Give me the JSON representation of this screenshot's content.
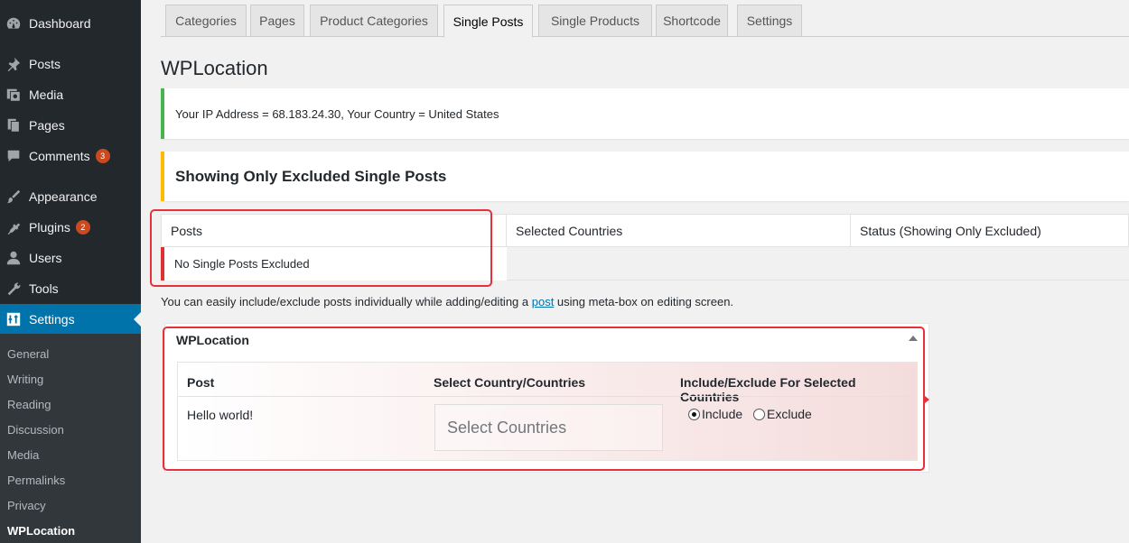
{
  "sidebar": {
    "items": [
      {
        "label": "Dashboard",
        "icon": "dashboard-icon"
      },
      {
        "label": "Posts",
        "icon": "pin-icon"
      },
      {
        "label": "Media",
        "icon": "media-icon"
      },
      {
        "label": "Pages",
        "icon": "pages-icon"
      },
      {
        "label": "Comments",
        "icon": "comment-icon",
        "badge": "3"
      },
      {
        "label": "Appearance",
        "icon": "brush-icon"
      },
      {
        "label": "Plugins",
        "icon": "plugin-icon",
        "badge": "2"
      },
      {
        "label": "Users",
        "icon": "user-icon"
      },
      {
        "label": "Tools",
        "icon": "wrench-icon"
      },
      {
        "label": "Settings",
        "icon": "settings-icon"
      }
    ],
    "submenu": [
      "General",
      "Writing",
      "Reading",
      "Discussion",
      "Media",
      "Permalinks",
      "Privacy",
      "WPLocation"
    ]
  },
  "tabs": [
    "Categories",
    "Pages",
    "Product Categories",
    "Single Posts",
    "Single Products",
    "Shortcode",
    "Settings"
  ],
  "page_title": "WPLocation",
  "ip_notice": "Your IP Address = 68.183.24.30, Your Country = United States",
  "excluded_notice": "Showing Only Excluded Single Posts",
  "table": {
    "headers": [
      "Posts",
      "Selected Countries",
      "Status (Showing Only Excluded)"
    ],
    "empty_row": "No Single Posts Excluded"
  },
  "info": {
    "before": "You can easily include/exclude posts individually while adding/editing a ",
    "link": "post",
    "after": " using meta-box on editing screen."
  },
  "metabox": {
    "title": "WPLocation",
    "headers": [
      "Post",
      "Select Country/Countries",
      "Include/Exclude For Selected Countries"
    ],
    "post_title": "Hello world!",
    "select_placeholder": "Select Countries",
    "radio_include": "Include",
    "radio_exclude": "Exclude",
    "selected": "Include"
  },
  "colors": {
    "sidebar_bg": "#23282d",
    "active_blue": "#0073aa",
    "success_green": "#46b450",
    "warning_yellow": "#ffb900",
    "error_red": "#dc3232",
    "highlight_red": "#e8303a"
  }
}
